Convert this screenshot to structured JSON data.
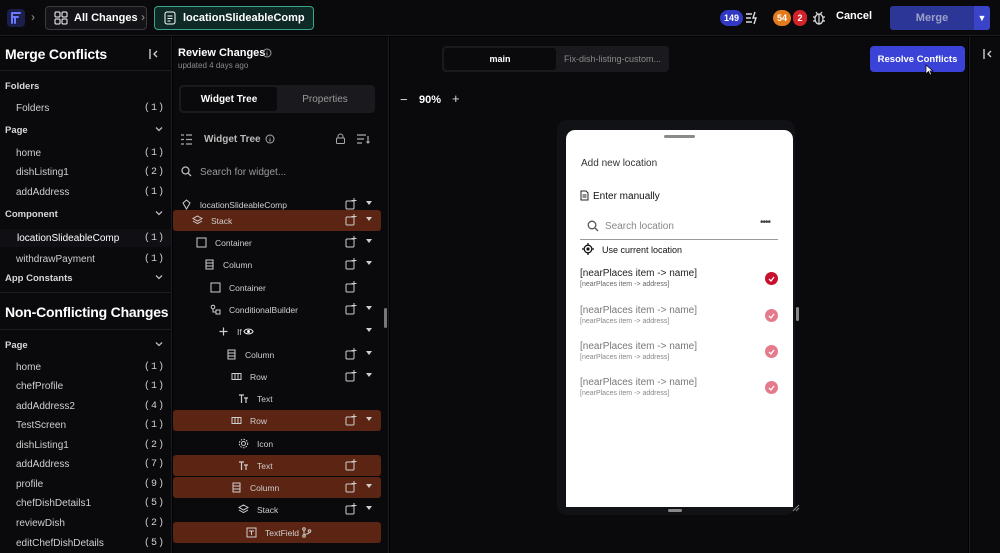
{
  "topbar": {
    "all_changes": "All Changes",
    "component": "locationSlideableComp",
    "badge_blue": "149",
    "badge_orange": "54",
    "badge_red": "2",
    "cancel": "Cancel",
    "merge": "Merge"
  },
  "left": {
    "title": "Merge Conflicts",
    "non_title": "Non-Conflicting Changes",
    "sections": {
      "folders": "Folders",
      "page": "Page",
      "component": "Component",
      "app_constants": "App Constants",
      "nc_page": "Page"
    },
    "folder_items": [
      {
        "label": "Folders",
        "count": "(1)"
      }
    ],
    "page_items": [
      {
        "label": "home",
        "count": "(1)"
      },
      {
        "label": "dishListing1",
        "count": "(2)"
      },
      {
        "label": "addAddress",
        "count": "(1)"
      }
    ],
    "component_items": [
      {
        "label": "locationSlideableComp",
        "count": "(1)"
      },
      {
        "label": "withdrawPayment",
        "count": "(1)"
      }
    ],
    "nc_page_items": [
      {
        "label": "home",
        "count": "(1)"
      },
      {
        "label": "chefProfile",
        "count": "(1)"
      },
      {
        "label": "addAddress2",
        "count": "(4)"
      },
      {
        "label": "TestScreen",
        "count": "(1)"
      },
      {
        "label": "dishListing1",
        "count": "(2)"
      },
      {
        "label": "addAddress",
        "count": "(7)"
      },
      {
        "label": "profile",
        "count": "(9)"
      },
      {
        "label": "chefDishDetails1",
        "count": "(5)"
      },
      {
        "label": "reviewDish",
        "count": "(2)"
      },
      {
        "label": "editChefDishDetails",
        "count": "(5)"
      }
    ]
  },
  "review": {
    "title": "Review Changes",
    "updated": "updated 4 days ago",
    "tab_widget_tree": "Widget Tree",
    "tab_properties": "Properties",
    "widget_tree_label": "Widget Tree",
    "search_placeholder": "Search for widget..."
  },
  "tree": [
    {
      "label": "locationSlideableComp",
      "icon": "diamond-icon",
      "hl": false
    },
    {
      "label": "Stack",
      "icon": "layers-icon",
      "hl": true
    },
    {
      "label": "Container",
      "icon": "square-icon",
      "hl": false
    },
    {
      "label": "Column",
      "icon": "column-icon",
      "hl": false
    },
    {
      "label": "Container",
      "icon": "square-icon",
      "hl": false
    },
    {
      "label": "ConditionalBuilder",
      "icon": "conditional-icon",
      "hl": false
    },
    {
      "label": "If",
      "icon": "plus-icon",
      "hl": false
    },
    {
      "label": "Column",
      "icon": "column-icon",
      "hl": false
    },
    {
      "label": "Row",
      "icon": "row-icon",
      "hl": false
    },
    {
      "label": "Text",
      "icon": "text-icon",
      "hl": false
    },
    {
      "label": "Row",
      "icon": "row-icon",
      "hl": true
    },
    {
      "label": "Icon",
      "icon": "gear-icon",
      "hl": false
    },
    {
      "label": "Text",
      "icon": "text-icon",
      "hl": true
    },
    {
      "label": "Column",
      "icon": "column-icon",
      "hl": true
    },
    {
      "label": "Stack",
      "icon": "layers-icon",
      "hl": false
    },
    {
      "label": "TextField",
      "icon": "textfield-icon",
      "hl": true
    }
  ],
  "canvas": {
    "branch_main": "main",
    "branch_other": "Fix-dish-listing-custom...",
    "resolve": "Resolve Conflicts",
    "zoom": "90%"
  },
  "phone": {
    "title": "Add new location",
    "manual": "Enter manually",
    "search_placeholder": "Search location",
    "search_dots": "••••",
    "use_current": "Use current location",
    "items": [
      {
        "name": "[nearPlaces item -> name]",
        "address": "[nearPlaces item -> address]",
        "check_color": "#c8102e"
      },
      {
        "name": "[nearPlaces item -> name]",
        "address": "[nearPlaces item -> address]",
        "check_color": "#e57a8c"
      },
      {
        "name": "[nearPlaces item -> name]",
        "address": "[nearPlaces item -> address]",
        "check_color": "#e57a8c"
      },
      {
        "name": "[nearPlaces item -> name]",
        "address": "[nearPlaces item -> address]",
        "check_color": "#e57a8c"
      }
    ]
  },
  "colors": {
    "accent": "#3b42d8",
    "conflict_highlight": "#5c2412",
    "active_crumb": "#3aa58a"
  }
}
